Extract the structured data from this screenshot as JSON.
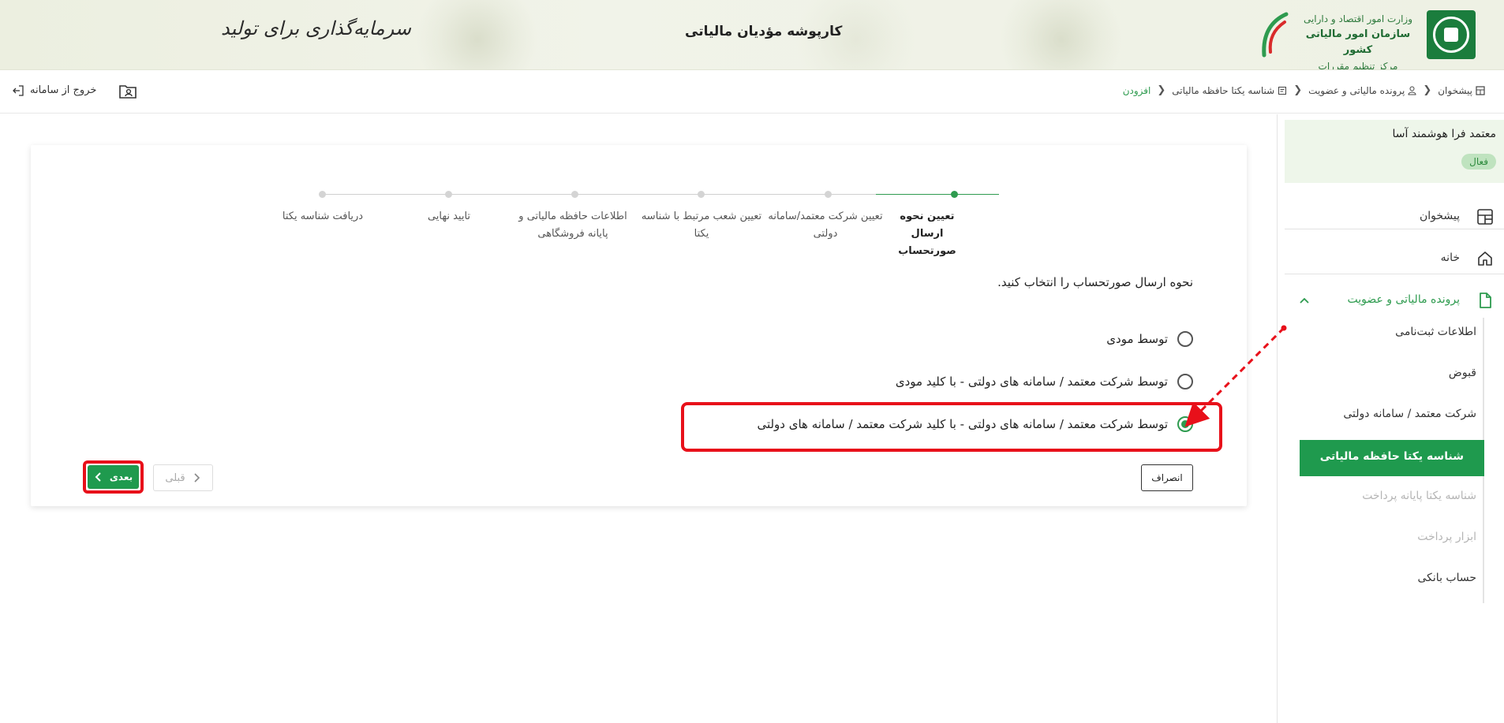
{
  "header": {
    "ministry_line1": "وزارت امور اقتصاد و دارایی",
    "ministry_line2": "سازمان امور مالیاتی کشور",
    "ministry_line3": "مرکز تنظیم مقررات",
    "title": "کارپوشه مؤدیان مالیاتی",
    "slogan": "سرمایه‌گذاری برای تولید"
  },
  "breadcrumb": [
    {
      "label": "پیشخوان"
    },
    {
      "label": "پرونده مالیاتی و عضویت"
    },
    {
      "label": "شناسه یکتا حافظه مالیاتی"
    },
    {
      "label": "افزودن"
    }
  ],
  "topbar": {
    "exit_label": "خروج از سامانه"
  },
  "sidebar": {
    "profile_name": "معتمد فرا هوشمند آسا",
    "status": "فعال",
    "items": [
      {
        "label": "پیشخوان",
        "icon": "dashboard-icon"
      },
      {
        "label": "خانه",
        "icon": "home-icon"
      },
      {
        "label": "پرونده مالیاتی و عضویت",
        "icon": "file-icon"
      }
    ],
    "sub_items": [
      {
        "label": "اطلاعات ثبت‌نامی"
      },
      {
        "label": "قبوض"
      },
      {
        "label": "شرکت معتمد / سامانه دولتی"
      },
      {
        "label": "شناسه یکتا حافظه مالیاتی"
      },
      {
        "label": "شناسه یکتا پایانه پرداخت"
      },
      {
        "label": "ابزار پرداخت"
      },
      {
        "label": "حساب بانکی"
      }
    ]
  },
  "stepper": {
    "steps": [
      {
        "label": "تعیین نحوه ارسال صورتحساب"
      },
      {
        "label": "تعیین شرکت معتمد/سامانه دولتی"
      },
      {
        "label": "تعیین شعب مرتبط با شناسه یکتا"
      },
      {
        "label": "اطلاعات حافظه مالیاتی و پایانه فروشگاهی"
      },
      {
        "label": "تایید نهایی"
      },
      {
        "label": "دریافت شناسه یکتا"
      }
    ]
  },
  "form": {
    "question": "نحوه ارسال صورتحساب را انتخاب کنید.",
    "options": [
      {
        "label": "توسط مودی",
        "checked": false
      },
      {
        "label": "توسط شرکت معتمد / سامانه های دولتی - با کلید مودی",
        "checked": false
      },
      {
        "label": "توسط شرکت معتمد / سامانه های دولتی - با کلید شرکت معتمد / سامانه های دولتی",
        "checked": true
      }
    ],
    "cancel_label": "انصراف",
    "prev_label": "قبلی",
    "next_label": "بعدی"
  },
  "colors": {
    "accent": "#1f9a4e",
    "highlight": "#e8101a"
  }
}
